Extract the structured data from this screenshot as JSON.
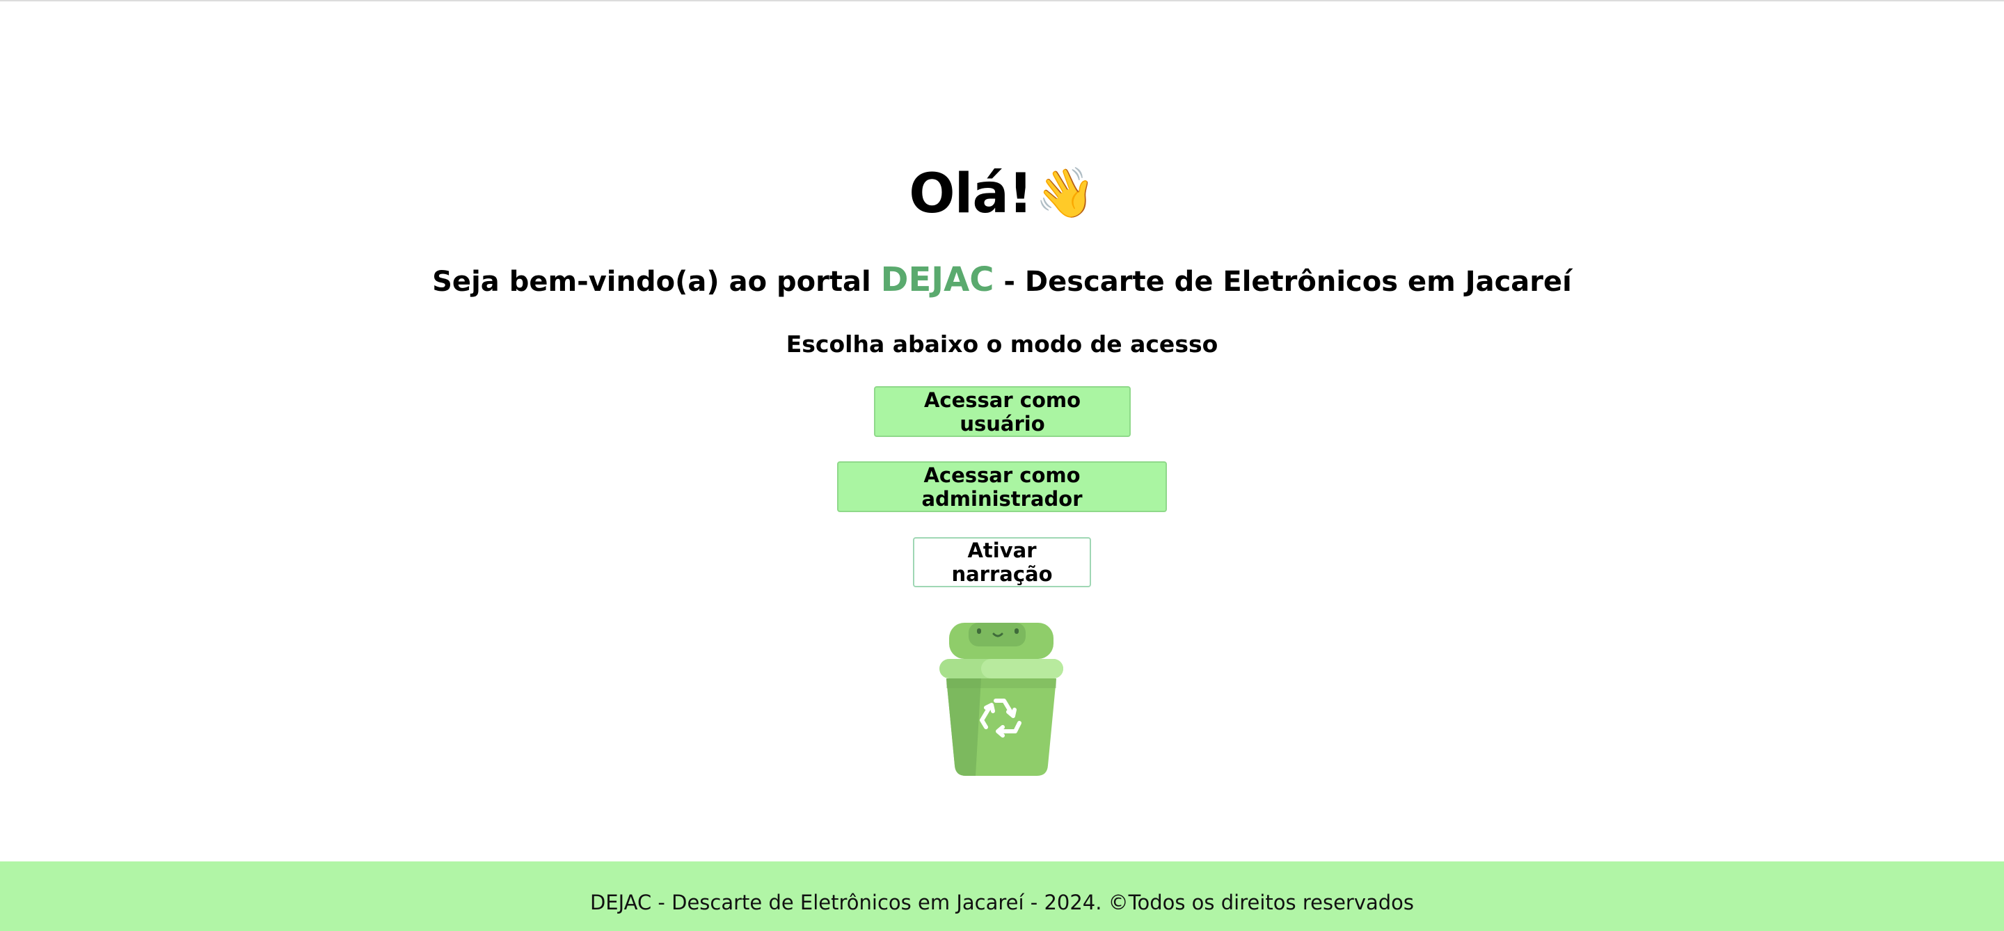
{
  "hero": {
    "greeting": "Olá!",
    "wave_emoji": "👋",
    "welcome_prefix": "Seja bem-vindo(a) ao portal",
    "brand": "DEJAC",
    "welcome_suffix": "- Descarte de Eletrônicos em Jacareí",
    "choose_text": "Escolha abaixo o modo de acesso"
  },
  "actions": {
    "user_label": "Acessar como usuário",
    "admin_label": "Acessar como administrador",
    "narration_label": "Ativar narração"
  },
  "illustration": {
    "icon": "recycle-bin-icon"
  },
  "footer": {
    "text": "DEJAC - Descarte de Eletrônicos em Jacareí - 2024. ©Todos os direitos reservados"
  },
  "colors": {
    "brand": "#5aaa6e",
    "button_bg": "#aaf5a2",
    "footer_bg": "#b1f5a6"
  }
}
